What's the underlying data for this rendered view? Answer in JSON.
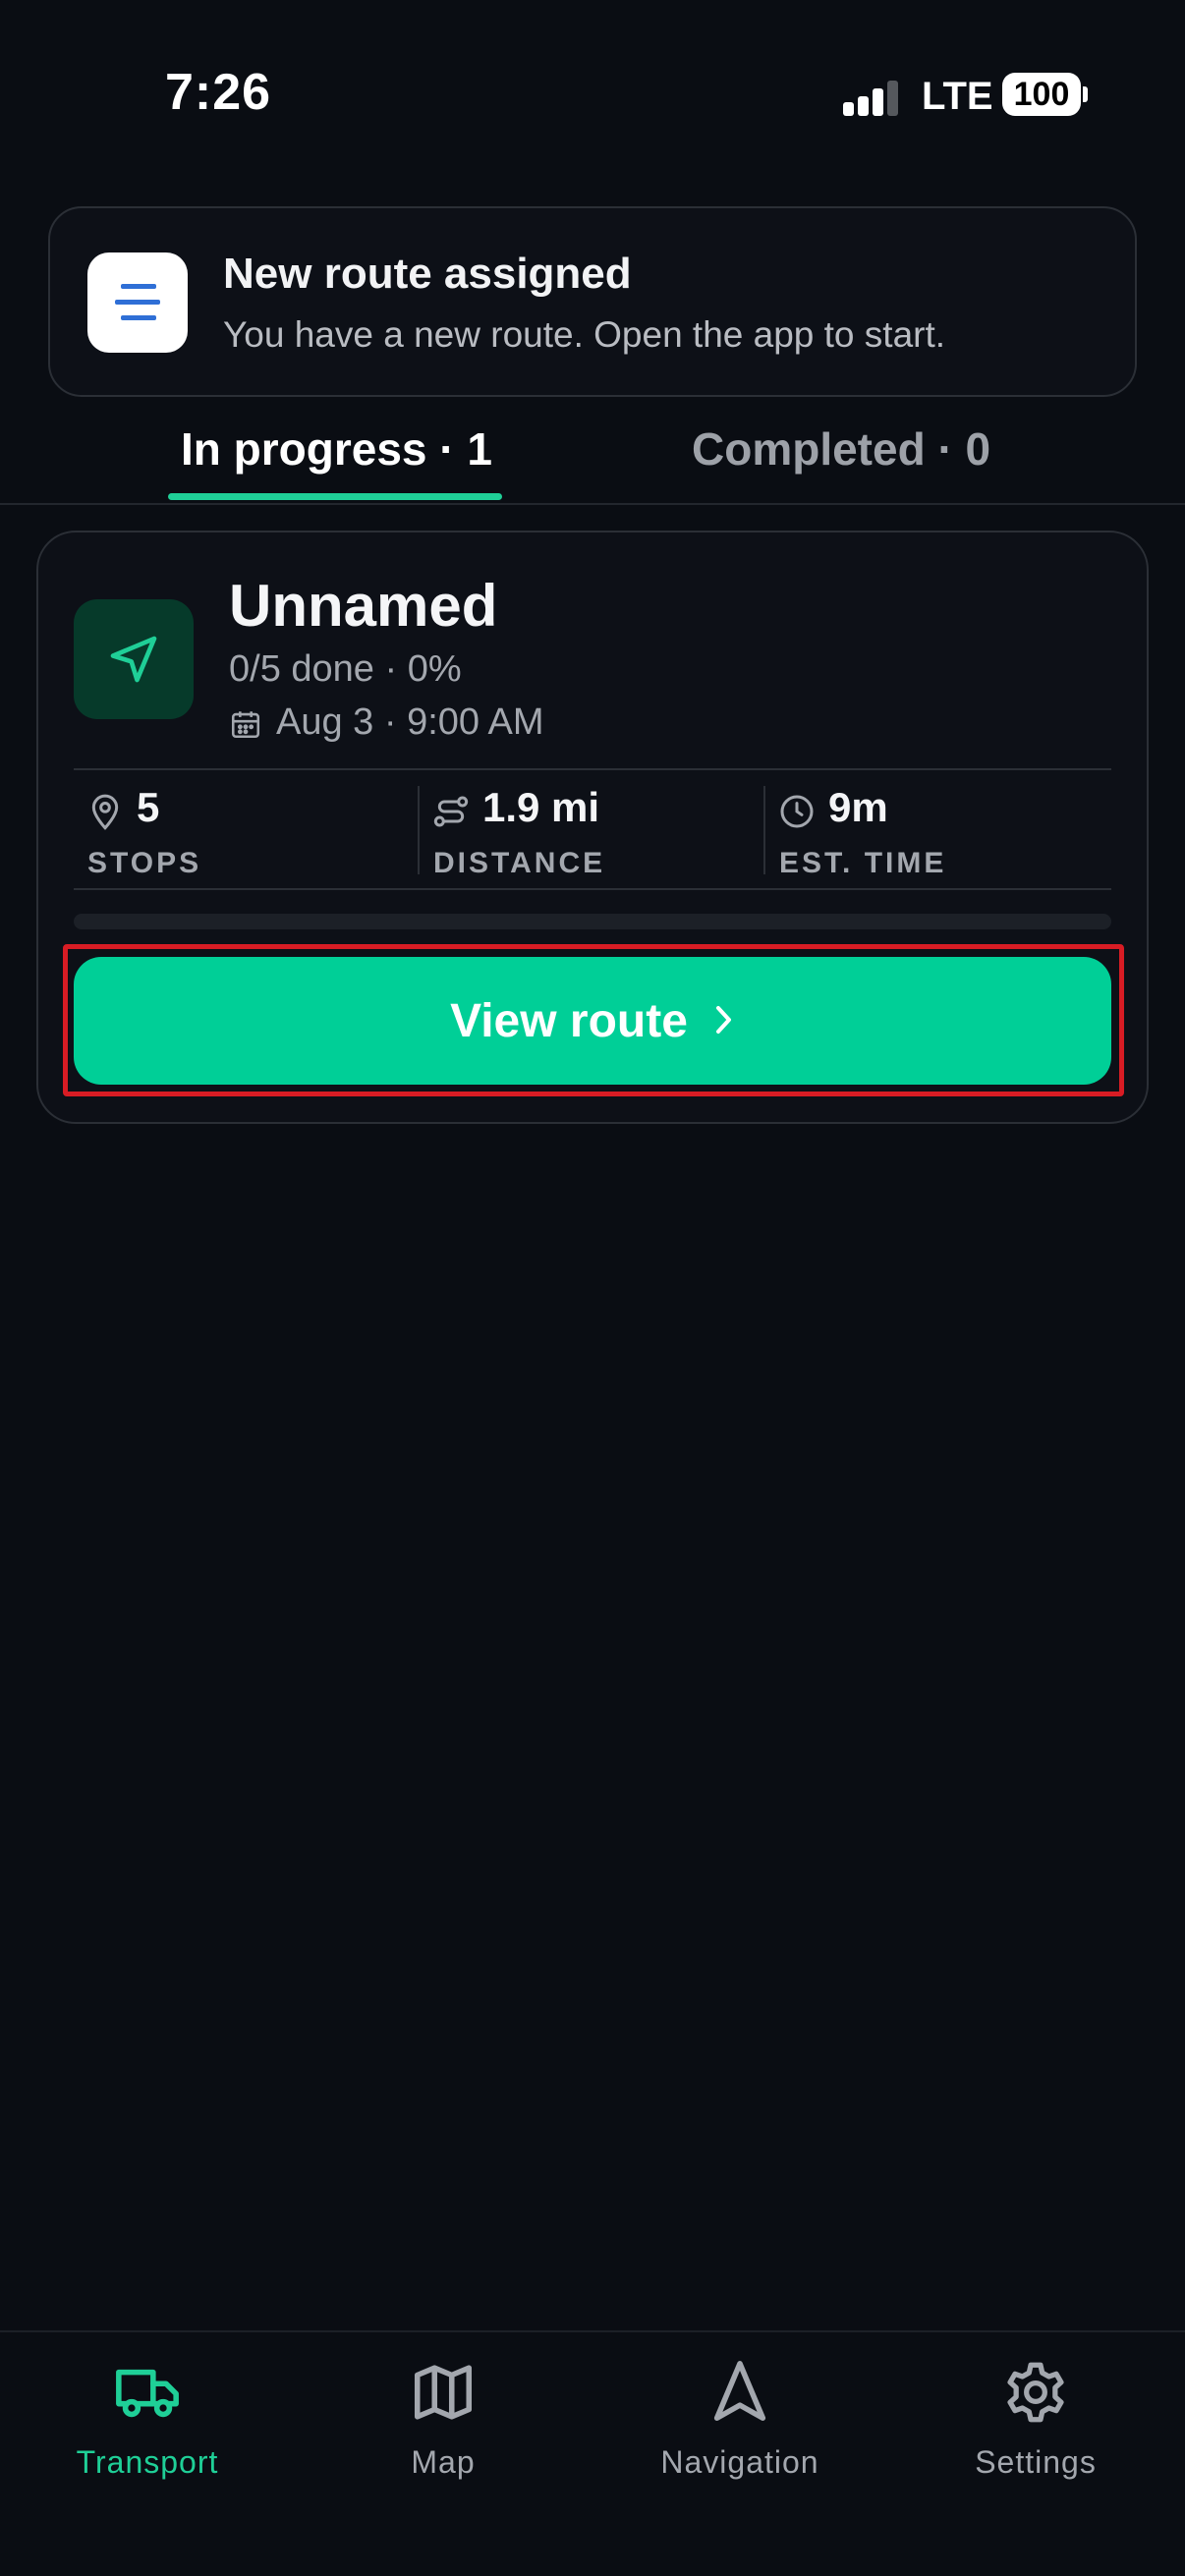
{
  "status_bar": {
    "time": "7:26",
    "network": "LTE",
    "battery": "100"
  },
  "notification": {
    "title": "New route assigned",
    "body": "You have a new route. Open the app to start."
  },
  "tabs": [
    {
      "label": "In progress · 1",
      "active": true
    },
    {
      "label": "Completed · 0",
      "active": false
    }
  ],
  "route": {
    "name": "Unnamed",
    "progress_text": "0/5 done · 0%",
    "progress_fraction": 0,
    "date": "Aug 3 · 9:00 AM",
    "stats": [
      {
        "icon": "map-pin-icon",
        "value": "5",
        "label": "STOPS"
      },
      {
        "icon": "route-icon",
        "value": "1.9 mi",
        "label": "DISTANCE"
      },
      {
        "icon": "clock-icon",
        "value": "9m",
        "label": "EST. TIME"
      }
    ],
    "button_label": "View route"
  },
  "bottom_nav": [
    {
      "label": "Transport",
      "icon": "truck-icon",
      "active": true
    },
    {
      "label": "Map",
      "icon": "map-icon",
      "active": false
    },
    {
      "label": "Navigation",
      "icon": "navigation-arrow-icon",
      "active": false
    },
    {
      "label": "Settings",
      "icon": "gear-icon",
      "active": false
    }
  ],
  "colors": {
    "accent": "#1fcf97",
    "button": "#00cf97",
    "background": "#0a0d13",
    "highlight_outline": "#d81c24"
  }
}
